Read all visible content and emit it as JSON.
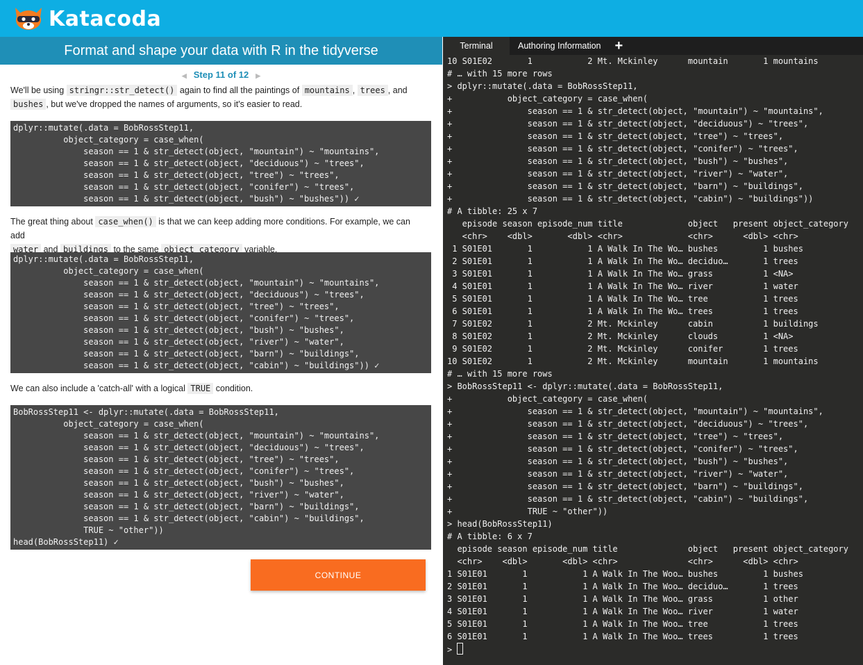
{
  "app": {
    "logo_text": "Katacoda"
  },
  "left": {
    "title": "Format and shape your data with R in the tidyverse",
    "step_label": "Step 11 of 12",
    "para1": {
      "t1": "We'll be using ",
      "c1": "stringr::str_detect()",
      "t2": " again to find all the paintings of ",
      "c2": "mountains",
      "t3": ", ",
      "c3": "trees",
      "t4": ", and",
      "c4": "bushes",
      "t5": ", but we've dropped the names of arguments, so it's easier to read."
    },
    "code1": [
      "dplyr::mutate(.data = BobRossStep11,",
      "          object_category = case_when(",
      "              season == 1 & str_detect(object, \"mountain\") ~ \"mountains\",",
      "              season == 1 & str_detect(object, \"deciduous\") ~ \"trees\",",
      "              season == 1 & str_detect(object, \"tree\") ~ \"trees\",",
      "              season == 1 & str_detect(object, \"conifer\") ~ \"trees\",",
      "              season == 1 & str_detect(object, \"bush\") ~ \"bushes\")) ✓"
    ],
    "para2": {
      "t1": "The great thing about ",
      "c1": "case_when()",
      "t2": " is that we can keep adding more conditions. For example, we can add",
      "c2": "water",
      "t3": " and ",
      "c3": "buildings",
      "t4": " to the same ",
      "c4": "object_category",
      "t5": " variable."
    },
    "code2": [
      "dplyr::mutate(.data = BobRossStep11,",
      "          object_category = case_when(",
      "              season == 1 & str_detect(object, \"mountain\") ~ \"mountains\",",
      "              season == 1 & str_detect(object, \"deciduous\") ~ \"trees\",",
      "              season == 1 & str_detect(object, \"tree\") ~ \"trees\",",
      "              season == 1 & str_detect(object, \"conifer\") ~ \"trees\",",
      "              season == 1 & str_detect(object, \"bush\") ~ \"bushes\",",
      "              season == 1 & str_detect(object, \"river\") ~ \"water\",",
      "              season == 1 & str_detect(object, \"barn\") ~ \"buildings\",",
      "              season == 1 & str_detect(object, \"cabin\") ~ \"buildings\")) ✓"
    ],
    "para3": {
      "t1": "We can also include a 'catch-all' with a logical ",
      "c1": "TRUE",
      "t2": " condition."
    },
    "code3": [
      "BobRossStep11 <- dplyr::mutate(.data = BobRossStep11,",
      "          object_category = case_when(",
      "              season == 1 & str_detect(object, \"mountain\") ~ \"mountains\",",
      "              season == 1 & str_detect(object, \"deciduous\") ~ \"trees\",",
      "              season == 1 & str_detect(object, \"tree\") ~ \"trees\",",
      "              season == 1 & str_detect(object, \"conifer\") ~ \"trees\",",
      "              season == 1 & str_detect(object, \"bush\") ~ \"bushes\",",
      "              season == 1 & str_detect(object, \"river\") ~ \"water\",",
      "              season == 1 & str_detect(object, \"barn\") ~ \"buildings\",",
      "              season == 1 & str_detect(object, \"cabin\") ~ \"buildings\",",
      "              TRUE ~ \"other\"))",
      "head(BobRossStep11) ✓"
    ],
    "continue_label": "CONTINUE"
  },
  "right": {
    "tabs": {
      "terminal": "Terminal",
      "authoring": "Authoring Information",
      "add": "+"
    },
    "terminal_lines": [
      "10 S01E02       1           2 Mt. Mckinley      mountain       1 mountains",
      "# … with 15 more rows",
      "> dplyr::mutate(.data = BobRossStep11,",
      "+           object_category = case_when(",
      "+               season == 1 & str_detect(object, \"mountain\") ~ \"mountains\",",
      "+               season == 1 & str_detect(object, \"deciduous\") ~ \"trees\",",
      "+               season == 1 & str_detect(object, \"tree\") ~ \"trees\",",
      "+               season == 1 & str_detect(object, \"conifer\") ~ \"trees\",",
      "+               season == 1 & str_detect(object, \"bush\") ~ \"bushes\",",
      "+               season == 1 & str_detect(object, \"river\") ~ \"water\",",
      "+               season == 1 & str_detect(object, \"barn\") ~ \"buildings\",",
      "+               season == 1 & str_detect(object, \"cabin\") ~ \"buildings\"))",
      "# A tibble: 25 x 7",
      "   episode season episode_num title             object   present object_category",
      "   <chr>    <dbl>       <dbl> <chr>             <chr>      <dbl> <chr>",
      " 1 S01E01       1           1 A Walk In The Wo… bushes         1 bushes",
      " 2 S01E01       1           1 A Walk In The Wo… deciduo…       1 trees",
      " 3 S01E01       1           1 A Walk In The Wo… grass          1 <NA>",
      " 4 S01E01       1           1 A Walk In The Wo… river          1 water",
      " 5 S01E01       1           1 A Walk In The Wo… tree           1 trees",
      " 6 S01E01       1           1 A Walk In The Wo… trees          1 trees",
      " 7 S01E02       1           2 Mt. Mckinley      cabin          1 buildings",
      " 8 S01E02       1           2 Mt. Mckinley      clouds         1 <NA>",
      " 9 S01E02       1           2 Mt. Mckinley      conifer        1 trees",
      "10 S01E02       1           2 Mt. Mckinley      mountain       1 mountains",
      "# … with 15 more rows",
      "> BobRossStep11 <- dplyr::mutate(.data = BobRossStep11,",
      "+           object_category = case_when(",
      "+               season == 1 & str_detect(object, \"mountain\") ~ \"mountains\",",
      "+               season == 1 & str_detect(object, \"deciduous\") ~ \"trees\",",
      "+               season == 1 & str_detect(object, \"tree\") ~ \"trees\",",
      "+               season == 1 & str_detect(object, \"conifer\") ~ \"trees\",",
      "+               season == 1 & str_detect(object, \"bush\") ~ \"bushes\",",
      "+               season == 1 & str_detect(object, \"river\") ~ \"water\",",
      "+               season == 1 & str_detect(object, \"barn\") ~ \"buildings\",",
      "+               season == 1 & str_detect(object, \"cabin\") ~ \"buildings\",",
      "+               TRUE ~ \"other\"))",
      "> head(BobRossStep11)",
      "# A tibble: 6 x 7",
      "  episode season episode_num title              object   present object_category",
      "  <chr>    <dbl>       <dbl> <chr>              <chr>      <dbl> <chr>",
      "1 S01E01       1           1 A Walk In The Woo… bushes         1 bushes",
      "2 S01E01       1           1 A Walk In The Woo… deciduo…       1 trees",
      "3 S01E01       1           1 A Walk In The Woo… grass          1 other",
      "4 S01E01       1           1 A Walk In The Woo… river          1 water",
      "5 S01E01       1           1 A Walk In The Woo… tree           1 trees",
      "6 S01E01       1           1 A Walk In The Woo… trees          1 trees"
    ],
    "prompt": "> "
  },
  "colors": {
    "topbar": "#0eaee3",
    "title_bar": "#1f8fb7",
    "code_bg": "#474747",
    "continue": "#f96c20",
    "terminal_bg": "#2b2b29"
  },
  "icons": [
    "katacoda-raccoon-logo",
    "chevron-left-icon",
    "chevron-right-icon",
    "plus-icon",
    "terminal-cursor"
  ]
}
